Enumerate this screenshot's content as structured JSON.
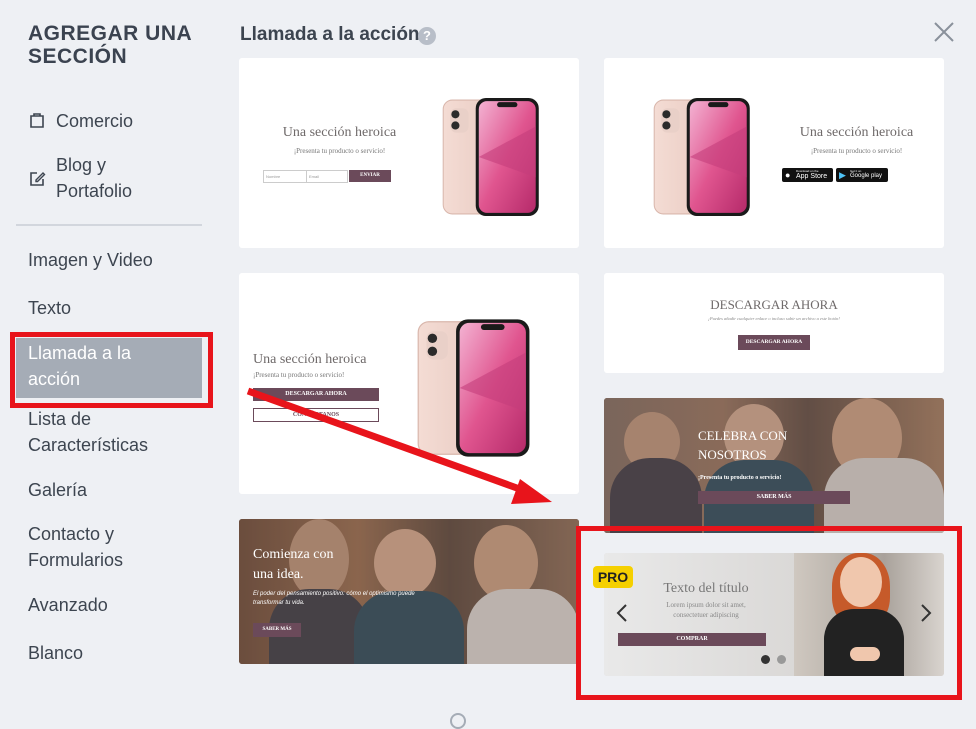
{
  "sidebar": {
    "title": "AGREGAR UNA SECCIÓN",
    "items": [
      {
        "label": "Comercio"
      },
      {
        "label": "Blog y Portafolio"
      },
      {
        "label": "Imagen y Video"
      },
      {
        "label": "Texto"
      },
      {
        "label": "Llamada a la acción"
      },
      {
        "label": "Lista de Características"
      },
      {
        "label": "Galería"
      },
      {
        "label": "Contacto y Formularios"
      },
      {
        "label": "Avanzado"
      },
      {
        "label": "Blanco"
      }
    ]
  },
  "main": {
    "heading": "Llamada a la acción",
    "help": "?"
  },
  "cards": {
    "c1": {
      "title": "Una sección heroica",
      "subtitle": "¡Presenta tu producto o servicio!",
      "ph_name": "Nombre",
      "ph_email": "Email",
      "button": "ENVIAR"
    },
    "c2": {
      "title": "Una sección heroica",
      "subtitle": "¡Presenta tu producto o servicio!",
      "appstore_small": "Download on the",
      "appstore": "App Store",
      "gplay_small": "Get it on",
      "gplay": "Google play"
    },
    "c3": {
      "title": "Una sección heroica",
      "subtitle": "¡Presenta tu producto o servicio!",
      "button1": "DESCARGAR AHORA",
      "button2": "CONTÁCTANOS"
    },
    "c4": {
      "title": "DESCARGAR AHORA",
      "subtitle": "¡Puedes añadir cualquier enlace o incluso subir un archivo a este botón!",
      "button": "DESCARGAR AHORA"
    },
    "c5": {
      "title": "CELEBRA CON NOSOTROS",
      "subtitle": "¡Presenta tu producto o servicio!",
      "button": "SABER MÁS"
    },
    "c6": {
      "title": "Comienza con una idea.",
      "subtitle": "El poder del pensamiento positivo: cómo el optimismo puede transformar tu vida.",
      "button": "SABER MÁS"
    },
    "c7": {
      "badge": "PRO",
      "title": "Texto del título",
      "subtitle": "Lorem ipsum dolor sit amet, consectetuer adipiscing",
      "button": "COMPRAR"
    }
  },
  "colors": {
    "accent_red": "#e8141b",
    "pro_yellow": "#f5d000",
    "button": "#6b4a5a",
    "active_bg": "#a5acb6"
  }
}
